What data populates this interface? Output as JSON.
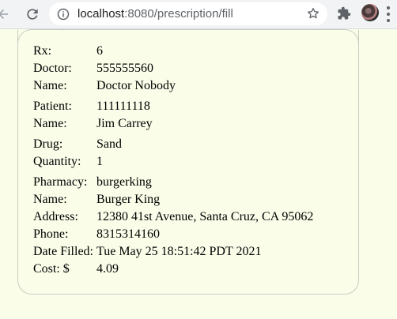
{
  "browser": {
    "url_host": "localhost",
    "url_rest": ":8080/prescription/fill"
  },
  "prescription": {
    "rx": {
      "label": "Rx:",
      "value": "6"
    },
    "doctor": {
      "label": "Doctor:",
      "value": "555555560"
    },
    "doctor_name": {
      "label": "Name:",
      "value": "Doctor Nobody"
    },
    "patient": {
      "label": "Patient:",
      "value": "111111118"
    },
    "patient_name": {
      "label": "Name:",
      "value": "Jim Carrey"
    },
    "drug": {
      "label": "Drug:",
      "value": "Sand"
    },
    "quantity": {
      "label": "Quantity:",
      "value": "1"
    },
    "pharmacy": {
      "label": "Pharmacy:",
      "value": "burgerking"
    },
    "pharmacy_name": {
      "label": "Name:",
      "value": "Burger King"
    },
    "address": {
      "label": "Address:",
      "value": "12380 41st Avenue, Santa Cruz, CA 95062"
    },
    "phone": {
      "label": "Phone:",
      "value": "8315314160"
    },
    "date_filled": {
      "label": "Date Filled:",
      "value": "Tue May 25 18:51:42 PDT 2021"
    },
    "cost": {
      "label": "Cost: $",
      "value": "4.09"
    }
  }
}
